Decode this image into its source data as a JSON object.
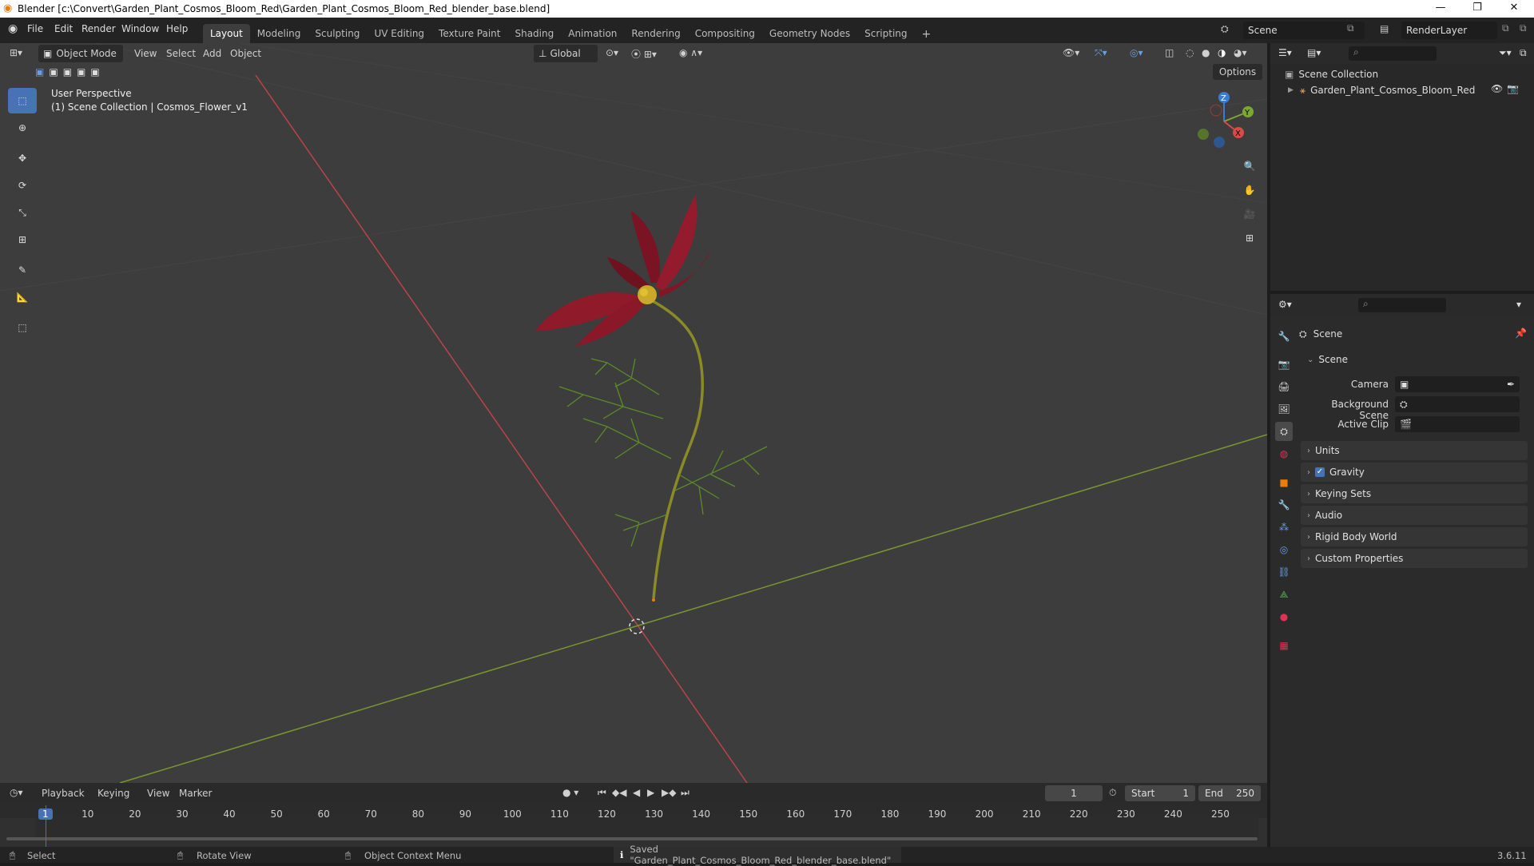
{
  "window": {
    "title": "Blender [c:\\Convert\\Garden_Plant_Cosmos_Bloom_Red\\Garden_Plant_Cosmos_Bloom_Red_blender_base.blend]",
    "minimize": "—",
    "maximize": "❐",
    "close": "✕"
  },
  "menus": {
    "file": "File",
    "edit": "Edit",
    "render": "Render",
    "window": "Window",
    "help": "Help"
  },
  "workspaces": [
    "Layout",
    "Modeling",
    "Sculpting",
    "UV Editing",
    "Texture Paint",
    "Shading",
    "Animation",
    "Rendering",
    "Compositing",
    "Geometry Nodes",
    "Scripting"
  ],
  "add_workspace": "+",
  "scene_selector": {
    "value": "Scene"
  },
  "renderlayer_selector": {
    "value": "RenderLayer"
  },
  "viewport_header": {
    "mode": "Object Mode",
    "view": "View",
    "select": "Select",
    "add": "Add",
    "object": "Object",
    "orientation": "Global",
    "options": "Options"
  },
  "viewport": {
    "perspective": "User Perspective",
    "context": "(1) Scene Collection | Cosmos_Flower_v1",
    "gizmo": {
      "x": "X",
      "y": "Y",
      "z": "Z"
    }
  },
  "outliner": {
    "root": "Scene Collection",
    "item": "Garden_Plant_Cosmos_Bloom_Red"
  },
  "properties": {
    "header": "Scene",
    "scene_panel": "Scene",
    "camera_label": "Camera",
    "background_label": "Background Scene",
    "clip_label": "Active Clip",
    "panels": [
      "Units",
      "Gravity",
      "Keying Sets",
      "Audio",
      "Rigid Body World",
      "Custom Properties"
    ],
    "gravity_checked": true
  },
  "timeline": {
    "playback": "Playback",
    "keying": "Keying",
    "view": "View",
    "marker": "Marker",
    "current_frame": "1",
    "start_label": "Start",
    "start": "1",
    "end_label": "End",
    "end": "250",
    "ticks": [
      "1",
      "10",
      "20",
      "30",
      "40",
      "50",
      "60",
      "70",
      "80",
      "90",
      "100",
      "110",
      "120",
      "130",
      "140",
      "150",
      "160",
      "170",
      "180",
      "190",
      "200",
      "210",
      "220",
      "230",
      "240",
      "250"
    ]
  },
  "status": {
    "select": "Select",
    "rotate": "Rotate View",
    "context_menu": "Object Context Menu",
    "message": "Saved \"Garden_Plant_Cosmos_Bloom_Red_blender_base.blend\"",
    "version": "3.6.11"
  },
  "colors": {
    "accent": "#4772b3",
    "x_axis": "#c24a4a",
    "y_axis": "#7c9a2e",
    "petal": "#8e1a2a"
  }
}
